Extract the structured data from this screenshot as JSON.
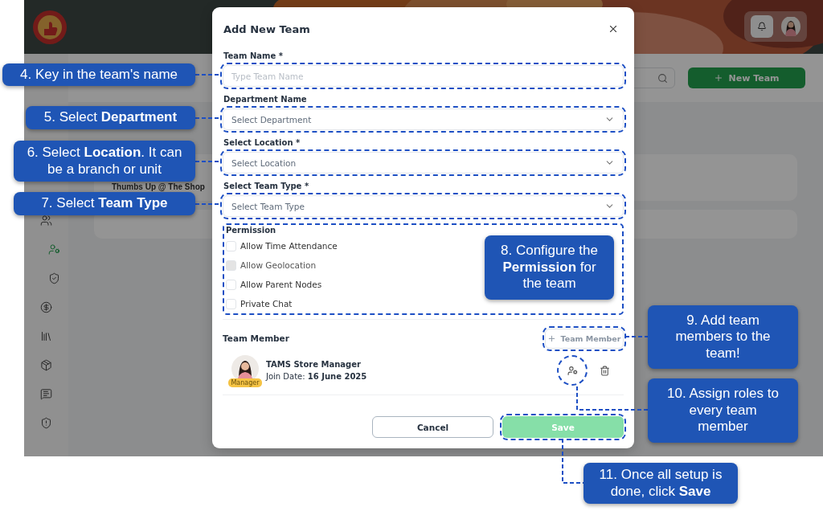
{
  "sidebar": {
    "items": [
      {
        "selected": false,
        "children": [
          {
            "selected": true
          },
          {
            "selected": false
          }
        ]
      },
      {
        "selected": false
      },
      {
        "selected": false
      },
      {
        "selected": false
      },
      {
        "selected": false
      },
      {
        "selected": false
      }
    ]
  },
  "toolbar": {
    "new_button": "New Team"
  },
  "list": {
    "cards": [
      {
        "title": "Thumbs Up @ The Shop"
      }
    ]
  },
  "dialog": {
    "title": "Add New Team",
    "fields": [
      {
        "label": "Team Name *",
        "placeholder": "Type Team Name",
        "kind": "text",
        "highlighted": true
      },
      {
        "label": "Department Name",
        "placeholder": "Select Department",
        "kind": "select",
        "highlighted": true
      },
      {
        "label": "Select Location *",
        "placeholder": "Select Location",
        "kind": "select",
        "highlighted": true
      },
      {
        "label": "Select Team Type *",
        "placeholder": "Select Team Type",
        "kind": "select",
        "highlighted": true
      }
    ],
    "permission": {
      "label": "Permission",
      "highlighted": true,
      "options": [
        {
          "label": "Allow Time Attendance",
          "checked": false,
          "disabled": false
        },
        {
          "label": "Allow Geolocation",
          "checked": false,
          "disabled": true
        },
        {
          "label": "Allow Parent Nodes",
          "checked": false,
          "disabled": false
        },
        {
          "label": "Private Chat",
          "checked": false,
          "disabled": false
        }
      ]
    },
    "members": {
      "label": "Team Member",
      "add_button": {
        "label": "Team Member",
        "highlighted": true
      },
      "items": [
        {
          "name": "TAMS Store Manager",
          "badge": "Manager",
          "join": "Join Date: **16 June 2025**",
          "role_button_highlighted": true
        }
      ]
    },
    "buttons": [
      {
        "label": "Cancel",
        "kind": "secondary",
        "highlighted": false
      },
      {
        "label": "Save",
        "kind": "primary",
        "disabled": true,
        "highlighted": true
      }
    ]
  },
  "callouts": [
    {
      "text": "4. Key in the team's name"
    },
    {
      "text": "5. Select **Department**"
    },
    {
      "text": "6. Select **Location**. It can be a branch or unit"
    },
    {
      "text": "7. Select **Team Type**"
    },
    {
      "text": "8. Configure the **Permission** for the team"
    },
    {
      "text": "9. Add team members to the team!"
    },
    {
      "text": "10. Assign roles to every team member"
    },
    {
      "text": "11. Once all setup is done, click **Save**"
    }
  ]
}
